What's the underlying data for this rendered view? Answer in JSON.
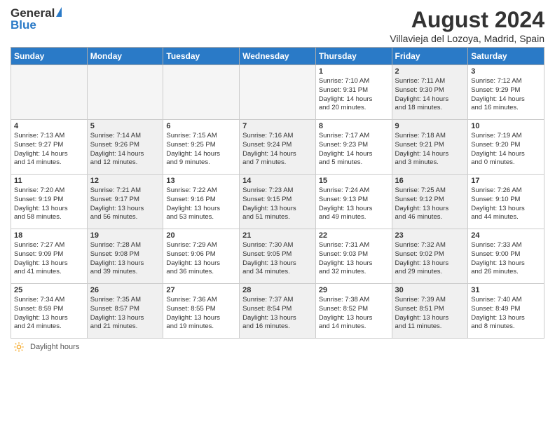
{
  "header": {
    "logo_general": "General",
    "logo_blue": "Blue",
    "month_year": "August 2024",
    "location": "Villavieja del Lozoya, Madrid, Spain"
  },
  "days_of_week": [
    "Sunday",
    "Monday",
    "Tuesday",
    "Wednesday",
    "Thursday",
    "Friday",
    "Saturday"
  ],
  "weeks": [
    [
      {
        "num": "",
        "info": "",
        "empty": true
      },
      {
        "num": "",
        "info": "",
        "empty": true
      },
      {
        "num": "",
        "info": "",
        "empty": true
      },
      {
        "num": "",
        "info": "",
        "empty": true
      },
      {
        "num": "1",
        "info": "Sunrise: 7:10 AM\nSunset: 9:31 PM\nDaylight: 14 hours\nand 20 minutes.",
        "empty": false,
        "shaded": false
      },
      {
        "num": "2",
        "info": "Sunrise: 7:11 AM\nSunset: 9:30 PM\nDaylight: 14 hours\nand 18 minutes.",
        "empty": false,
        "shaded": true
      },
      {
        "num": "3",
        "info": "Sunrise: 7:12 AM\nSunset: 9:29 PM\nDaylight: 14 hours\nand 16 minutes.",
        "empty": false,
        "shaded": false
      }
    ],
    [
      {
        "num": "4",
        "info": "Sunrise: 7:13 AM\nSunset: 9:27 PM\nDaylight: 14 hours\nand 14 minutes.",
        "empty": false,
        "shaded": false
      },
      {
        "num": "5",
        "info": "Sunrise: 7:14 AM\nSunset: 9:26 PM\nDaylight: 14 hours\nand 12 minutes.",
        "empty": false,
        "shaded": true
      },
      {
        "num": "6",
        "info": "Sunrise: 7:15 AM\nSunset: 9:25 PM\nDaylight: 14 hours\nand 9 minutes.",
        "empty": false,
        "shaded": false
      },
      {
        "num": "7",
        "info": "Sunrise: 7:16 AM\nSunset: 9:24 PM\nDaylight: 14 hours\nand 7 minutes.",
        "empty": false,
        "shaded": true
      },
      {
        "num": "8",
        "info": "Sunrise: 7:17 AM\nSunset: 9:23 PM\nDaylight: 14 hours\nand 5 minutes.",
        "empty": false,
        "shaded": false
      },
      {
        "num": "9",
        "info": "Sunrise: 7:18 AM\nSunset: 9:21 PM\nDaylight: 14 hours\nand 3 minutes.",
        "empty": false,
        "shaded": true
      },
      {
        "num": "10",
        "info": "Sunrise: 7:19 AM\nSunset: 9:20 PM\nDaylight: 14 hours\nand 0 minutes.",
        "empty": false,
        "shaded": false
      }
    ],
    [
      {
        "num": "11",
        "info": "Sunrise: 7:20 AM\nSunset: 9:19 PM\nDaylight: 13 hours\nand 58 minutes.",
        "empty": false,
        "shaded": false
      },
      {
        "num": "12",
        "info": "Sunrise: 7:21 AM\nSunset: 9:17 PM\nDaylight: 13 hours\nand 56 minutes.",
        "empty": false,
        "shaded": true
      },
      {
        "num": "13",
        "info": "Sunrise: 7:22 AM\nSunset: 9:16 PM\nDaylight: 13 hours\nand 53 minutes.",
        "empty": false,
        "shaded": false
      },
      {
        "num": "14",
        "info": "Sunrise: 7:23 AM\nSunset: 9:15 PM\nDaylight: 13 hours\nand 51 minutes.",
        "empty": false,
        "shaded": true
      },
      {
        "num": "15",
        "info": "Sunrise: 7:24 AM\nSunset: 9:13 PM\nDaylight: 13 hours\nand 49 minutes.",
        "empty": false,
        "shaded": false
      },
      {
        "num": "16",
        "info": "Sunrise: 7:25 AM\nSunset: 9:12 PM\nDaylight: 13 hours\nand 46 minutes.",
        "empty": false,
        "shaded": true
      },
      {
        "num": "17",
        "info": "Sunrise: 7:26 AM\nSunset: 9:10 PM\nDaylight: 13 hours\nand 44 minutes.",
        "empty": false,
        "shaded": false
      }
    ],
    [
      {
        "num": "18",
        "info": "Sunrise: 7:27 AM\nSunset: 9:09 PM\nDaylight: 13 hours\nand 41 minutes.",
        "empty": false,
        "shaded": false
      },
      {
        "num": "19",
        "info": "Sunrise: 7:28 AM\nSunset: 9:08 PM\nDaylight: 13 hours\nand 39 minutes.",
        "empty": false,
        "shaded": true
      },
      {
        "num": "20",
        "info": "Sunrise: 7:29 AM\nSunset: 9:06 PM\nDaylight: 13 hours\nand 36 minutes.",
        "empty": false,
        "shaded": false
      },
      {
        "num": "21",
        "info": "Sunrise: 7:30 AM\nSunset: 9:05 PM\nDaylight: 13 hours\nand 34 minutes.",
        "empty": false,
        "shaded": true
      },
      {
        "num": "22",
        "info": "Sunrise: 7:31 AM\nSunset: 9:03 PM\nDaylight: 13 hours\nand 32 minutes.",
        "empty": false,
        "shaded": false
      },
      {
        "num": "23",
        "info": "Sunrise: 7:32 AM\nSunset: 9:02 PM\nDaylight: 13 hours\nand 29 minutes.",
        "empty": false,
        "shaded": true
      },
      {
        "num": "24",
        "info": "Sunrise: 7:33 AM\nSunset: 9:00 PM\nDaylight: 13 hours\nand 26 minutes.",
        "empty": false,
        "shaded": false
      }
    ],
    [
      {
        "num": "25",
        "info": "Sunrise: 7:34 AM\nSunset: 8:59 PM\nDaylight: 13 hours\nand 24 minutes.",
        "empty": false,
        "shaded": false
      },
      {
        "num": "26",
        "info": "Sunrise: 7:35 AM\nSunset: 8:57 PM\nDaylight: 13 hours\nand 21 minutes.",
        "empty": false,
        "shaded": true
      },
      {
        "num": "27",
        "info": "Sunrise: 7:36 AM\nSunset: 8:55 PM\nDaylight: 13 hours\nand 19 minutes.",
        "empty": false,
        "shaded": false
      },
      {
        "num": "28",
        "info": "Sunrise: 7:37 AM\nSunset: 8:54 PM\nDaylight: 13 hours\nand 16 minutes.",
        "empty": false,
        "shaded": true
      },
      {
        "num": "29",
        "info": "Sunrise: 7:38 AM\nSunset: 8:52 PM\nDaylight: 13 hours\nand 14 minutes.",
        "empty": false,
        "shaded": false
      },
      {
        "num": "30",
        "info": "Sunrise: 7:39 AM\nSunset: 8:51 PM\nDaylight: 13 hours\nand 11 minutes.",
        "empty": false,
        "shaded": true
      },
      {
        "num": "31",
        "info": "Sunrise: 7:40 AM\nSunset: 8:49 PM\nDaylight: 13 hours\nand 8 minutes.",
        "empty": false,
        "shaded": false
      }
    ]
  ],
  "footer": {
    "daylight_label": "Daylight hours"
  }
}
